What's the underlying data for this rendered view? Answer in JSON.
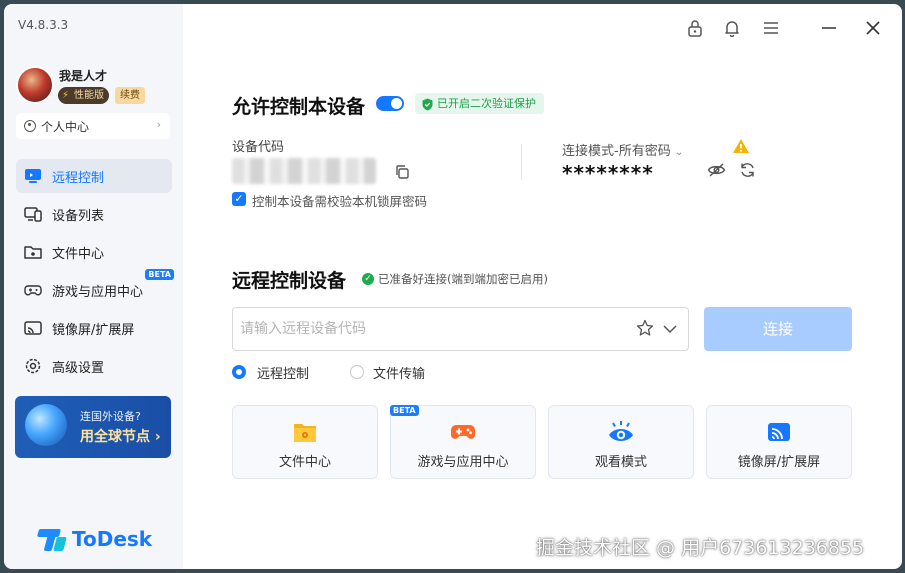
{
  "app": {
    "version": "V4.8.3.3",
    "logo_text": "ToDesk"
  },
  "user": {
    "name": "我是人才",
    "tier_badge": "性能版",
    "renew_badge": "续费",
    "personal_center": "个人中心"
  },
  "sidebar": {
    "items": [
      {
        "label": "远程控制",
        "icon": "monitor-icon",
        "active": true
      },
      {
        "label": "设备列表",
        "icon": "device-list-icon",
        "active": false
      },
      {
        "label": "文件中心",
        "icon": "folder-icon",
        "active": false
      },
      {
        "label": "游戏与应用中心",
        "icon": "gamepad-icon",
        "active": false,
        "badge": "BETA"
      },
      {
        "label": "镜像屏/扩展屏",
        "icon": "cast-icon",
        "active": false
      },
      {
        "label": "高级设置",
        "icon": "gear-icon",
        "active": false
      }
    ],
    "promo": {
      "line1": "连国外设备?",
      "line2": "用全球节点 ›"
    }
  },
  "allow_section": {
    "title": "允许控制本设备",
    "toggle_on": true,
    "verify_badge": "已开启二次验证保护",
    "device_code_label": "设备代码",
    "mode_label": "连接模式-所有密码",
    "password_masked": "********",
    "lock_screen_checkbox": "控制本设备需校验本机锁屏密码",
    "lock_screen_checked": true
  },
  "remote_section": {
    "title": "远程控制设备",
    "status": "已准备好连接(端到端加密已启用)",
    "input_placeholder": "请输入远程设备代码",
    "connect_button": "连接",
    "modes": [
      {
        "label": "远程控制",
        "selected": true
      },
      {
        "label": "文件传输",
        "selected": false
      }
    ],
    "cards": [
      {
        "label": "文件中心",
        "icon": "folder-icon"
      },
      {
        "label": "游戏与应用中心",
        "icon": "gamepad-icon",
        "badge": "BETA"
      },
      {
        "label": "观看模式",
        "icon": "eye-icon"
      },
      {
        "label": "镜像屏/扩展屏",
        "icon": "cast-icon"
      }
    ]
  },
  "watermark": "掘金技术社区 @ 用户673613236855",
  "colors": {
    "accent": "#1677ff",
    "success": "#1a9e4b",
    "connect_disabled": "#a8ccff",
    "sidebar_bg": "#f4f6f9"
  }
}
